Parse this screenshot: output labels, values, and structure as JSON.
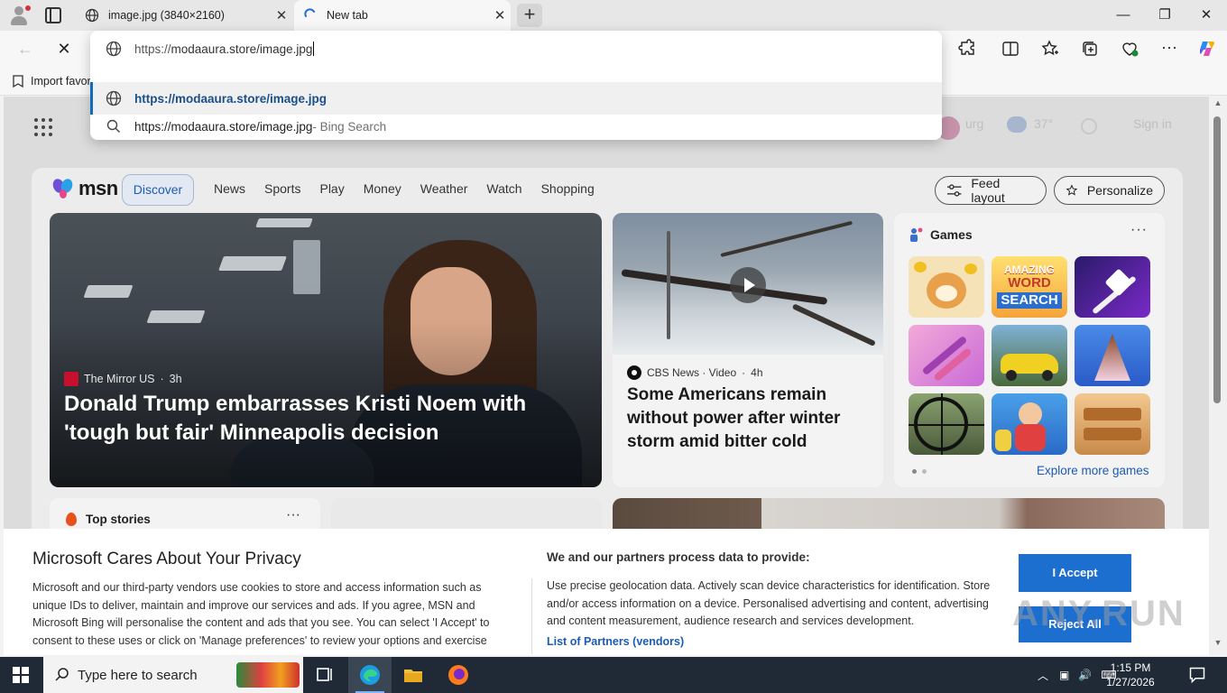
{
  "browser": {
    "tabs": [
      {
        "label": "image.jpg (3840×2160)",
        "icon": "globe-icon",
        "active": false
      },
      {
        "label": "New tab",
        "icon": "loading-icon",
        "active": true
      }
    ],
    "new_tab_label": "+",
    "window_controls": {
      "minimize": "—",
      "maximize": "❐",
      "close": "✕"
    },
    "toolbar": {
      "back": "←",
      "stop": "✕"
    },
    "bookmarks_bar": {
      "import_label": "Import favor"
    }
  },
  "omnibox": {
    "input_prefix": "https://",
    "input_value": "modaaura.store/image.jpg",
    "suggestions": [
      {
        "text": "https://modaaura.store/image.jpg",
        "type": "url",
        "selected": true
      },
      {
        "text": "https://modaaura.store/image.jpg",
        "suffix": " - Bing Search",
        "type": "search",
        "selected": false
      }
    ]
  },
  "page_header": {
    "ghost_weather": "urg",
    "ghost_temp": "37°",
    "ghost_signin": "Sign in"
  },
  "msn": {
    "logo_text": "msn",
    "nav": {
      "active": "Discover",
      "links": [
        "News",
        "Sports",
        "Play",
        "Money",
        "Weather",
        "Watch",
        "Shopping"
      ]
    },
    "feed_layout_label": "Feed layout",
    "personalize_label": "Personalize",
    "hero": {
      "source": "The Mirror US",
      "age": "3h",
      "headline": "Donald Trump embarrasses Kristi Noem with 'tough but fair' Minneapolis decision"
    },
    "video_card": {
      "source": "CBS News · Video",
      "age": "4h",
      "headline": "Some Americans remain without power after winter storm amid bitter cold"
    },
    "games": {
      "title": "Games",
      "more": "···",
      "explore_label": "Explore more games",
      "tiles": [
        "shiba-inu-game",
        "amazing-word-search",
        "rocket-game",
        "makeup-game",
        "sports-car-game",
        "ice-cream-game",
        "deer-hunter-game",
        "cartoon-characters-game",
        "wood-puzzle-game"
      ],
      "word_search_line1": "AMAZING",
      "word_search_line2": "WORD",
      "word_search_line3": "SEARCH"
    },
    "top_stories": {
      "title": "Top stories",
      "more": "···"
    }
  },
  "privacy": {
    "title": "Microsoft Cares About Your Privacy",
    "body": "Microsoft and our third-party vendors use cookies to store and access information such as unique IDs to deliver, maintain and improve our services and ads. If you agree, MSN and Microsoft Bing will personalise the content and ads that you see. You can select 'I Accept' to consent to these uses or click on 'Manage preferences' to review your options and exercise",
    "data_heading": "We and our partners process data to provide:",
    "data_body": "Use precise geolocation data. Actively scan device characteristics for identification. Store and/or access information on a device. Personalised advertising and content, advertising and content measurement, audience research and services development.",
    "partners_link": "List of Partners (vendors)",
    "accept_label": "I Accept",
    "reject_label": "Reject All",
    "watermark": "ANY.RUN"
  },
  "taskbar": {
    "search_placeholder": "Type here to search",
    "time": "1:15 PM",
    "date": "1/27/2026"
  },
  "colors": {
    "accent": "#1c6fcf",
    "taskbar": "#1f2a36",
    "link": "#1c5bb3"
  }
}
